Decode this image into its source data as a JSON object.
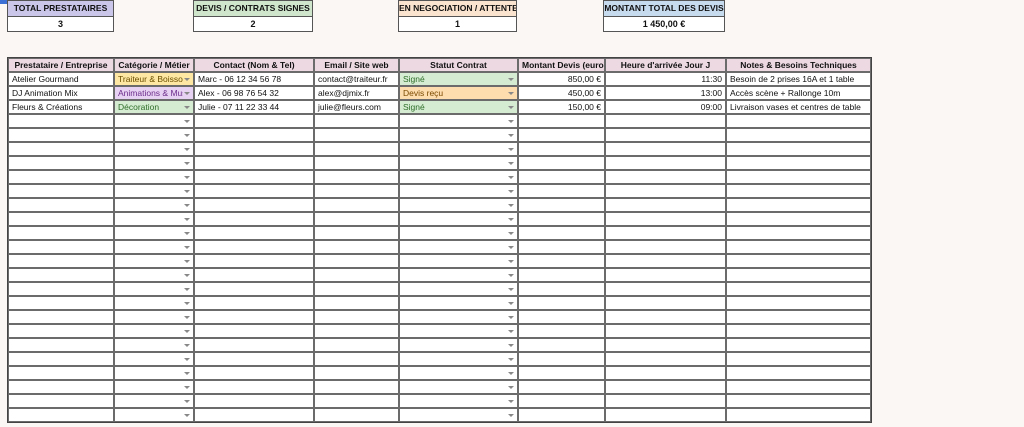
{
  "kpis": [
    {
      "label": "TOTAL PRESTATAIRES",
      "value": "3",
      "color": "#c9c6ea"
    },
    {
      "label": "DEVIS / CONTRATS SIGNES",
      "value": "2",
      "color": "#cfe6cc"
    },
    {
      "label": "EN NEGOCIATION / ATTENTE",
      "value": "1",
      "color": "#fbe4cf"
    },
    {
      "label": "MONTANT TOTAL DES DEVIS",
      "value": "1 450,00 €",
      "color": "#c7dbef"
    }
  ],
  "columns": [
    "Prestataire / Entreprise",
    "Catégorie / Métier",
    "Contact (Nom & Tel)",
    "Email / Site web",
    "Statut Contrat",
    "Montant Devis (euro)",
    "Heure d'arrivée Jour J",
    "Notes & Besoins Techniques"
  ],
  "rows": [
    {
      "name": "Atelier Gourmand",
      "category": "Traiteur & Boisso",
      "category_color": "yellow",
      "contact": "Marc - 06 12 34 56 78",
      "email": "contact@traiteur.fr",
      "status": "Signé",
      "status_color": "green",
      "amount": "850,00 €",
      "time": "11:30",
      "notes": "Besoin de 2 prises 16A et 1 table"
    },
    {
      "name": "DJ Animation Mix",
      "category": "Animations & Mus",
      "category_color": "purple",
      "contact": "Alex - 06 98 76 54 32",
      "email": "alex@djmix.fr",
      "status": "Devis reçu",
      "status_color": "orange",
      "amount": "450,00 €",
      "time": "13:00",
      "notes": "Accès scène + Rallonge 10m"
    },
    {
      "name": "Fleurs & Créations",
      "category": "Décoration",
      "category_color": "green",
      "contact": "Julie - 07 11 22 33 44",
      "email": "julie@fleurs.com",
      "status": "Signé",
      "status_color": "green",
      "amount": "150,00 €",
      "time": "09:00",
      "notes": "Livraison vases et centres de table"
    }
  ],
  "empty_row_count": 22
}
